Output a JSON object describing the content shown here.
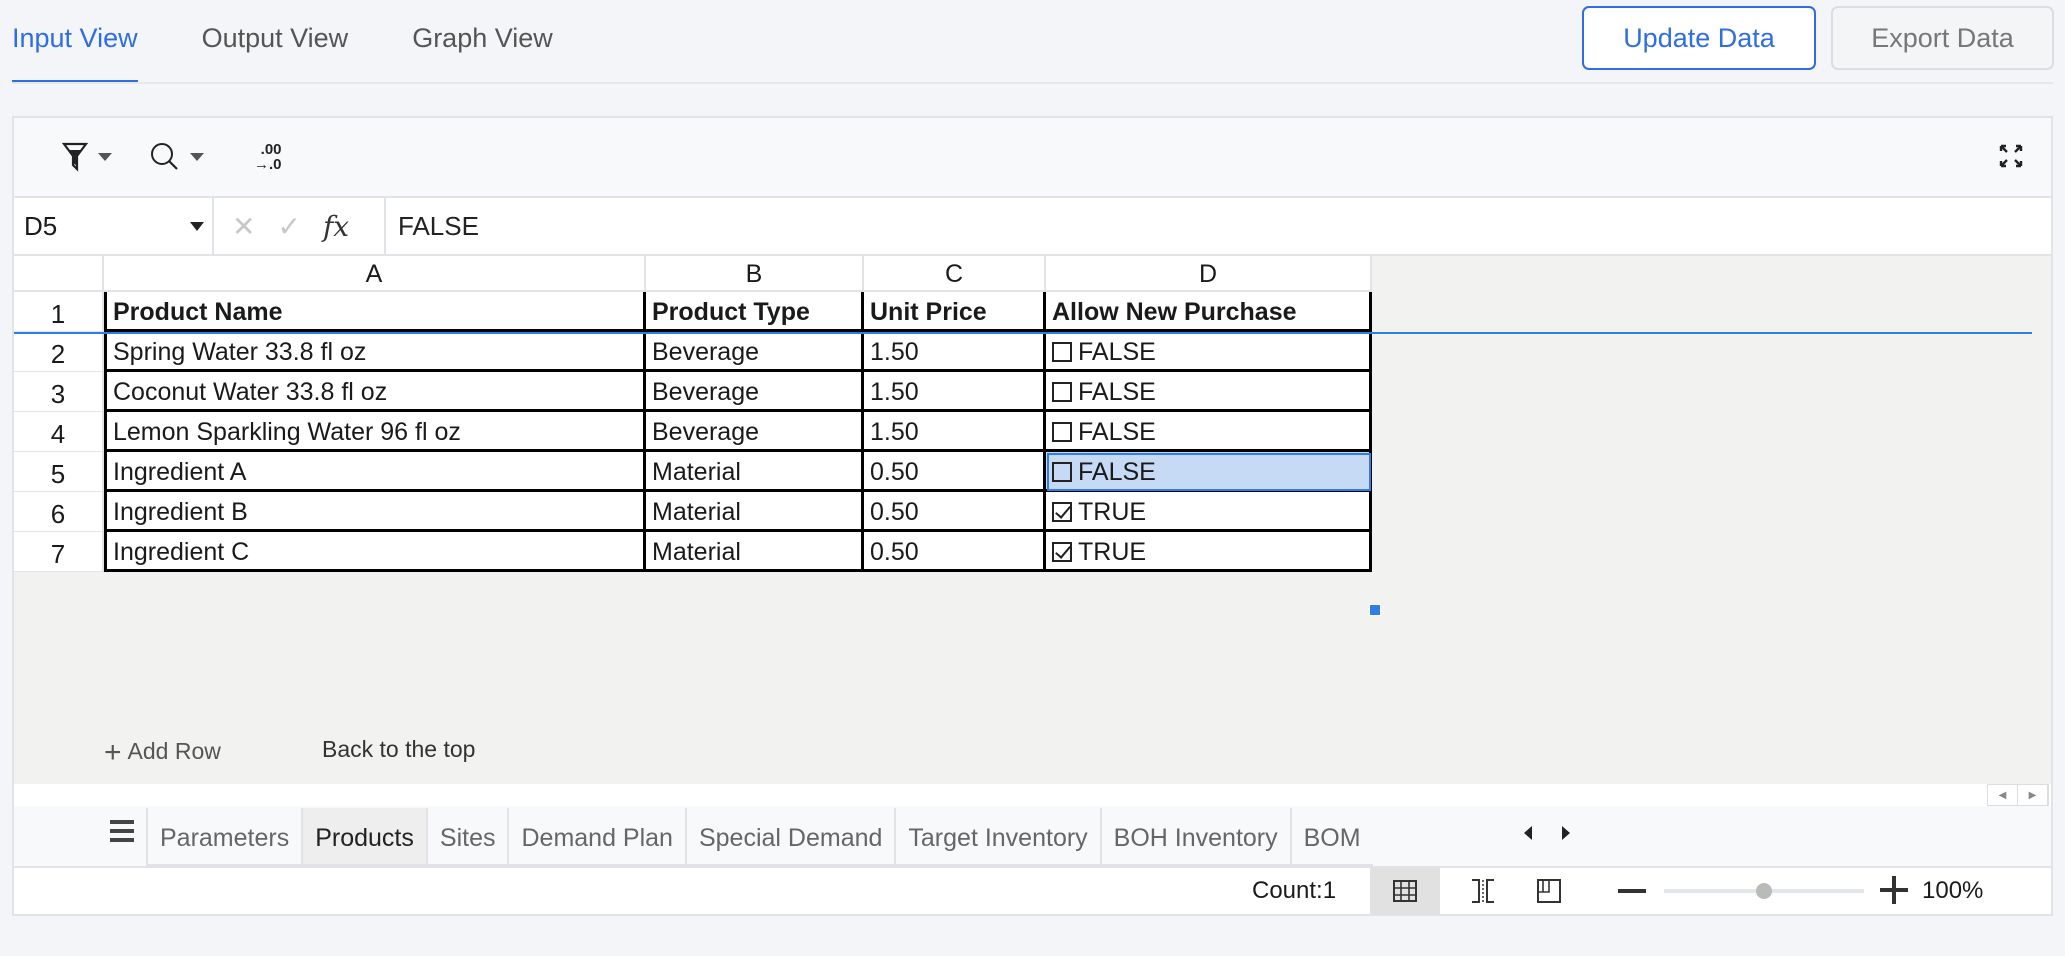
{
  "view_tabs": [
    {
      "label": "Input View",
      "active": true
    },
    {
      "label": "Output View",
      "active": false
    },
    {
      "label": "Graph View",
      "active": false
    }
  ],
  "actions": {
    "update": "Update Data",
    "export": "Export Data"
  },
  "toolbar": {
    "icons": [
      "filter-icon",
      "search-icon",
      "decrease-decimal-icon",
      "fullscreen-icon"
    ],
    "decimal_top": ".00",
    "decimal_bottom": "→.0"
  },
  "formula_bar": {
    "cell_ref": "D5",
    "cancel_glyph": "✕",
    "confirm_glyph": "✓",
    "fx_label": "fx",
    "value": "FALSE"
  },
  "grid": {
    "columns": [
      "A",
      "B",
      "C",
      "D"
    ],
    "header_row": {
      "num": "1",
      "cells": [
        "Product Name",
        "Product Type",
        "Unit Price",
        "Allow New Purchase"
      ]
    },
    "rows": [
      {
        "num": "2",
        "name": "Spring Water 33.8 fl oz",
        "type": "Beverage",
        "price": "1.50",
        "allow": "FALSE"
      },
      {
        "num": "3",
        "name": "Coconut Water 33.8 fl oz",
        "type": "Beverage",
        "price": "1.50",
        "allow": "FALSE"
      },
      {
        "num": "4",
        "name": "Lemon Sparkling Water 96 fl oz",
        "type": "Beverage",
        "price": "1.50",
        "allow": "FALSE"
      },
      {
        "num": "5",
        "name": "Ingredient A",
        "type": "Material",
        "price": "0.50",
        "allow": "FALSE"
      },
      {
        "num": "6",
        "name": "Ingredient B",
        "type": "Material",
        "price": "0.50",
        "allow": "TRUE"
      },
      {
        "num": "7",
        "name": "Ingredient C",
        "type": "Material",
        "price": "0.50",
        "allow": "TRUE"
      }
    ],
    "selected_cell": "D5"
  },
  "links": {
    "add_row": "Add Row",
    "add_row_glyph": "+",
    "back_top": "Back to the top"
  },
  "sheet_tabs": [
    {
      "label": "Parameters",
      "active": false
    },
    {
      "label": "Products",
      "active": true
    },
    {
      "label": "Sites",
      "active": false
    },
    {
      "label": "Demand Plan",
      "active": false
    },
    {
      "label": "Special Demand",
      "active": false
    },
    {
      "label": "Target Inventory",
      "active": false
    },
    {
      "label": "BOH Inventory",
      "active": false
    },
    {
      "label": "BOM",
      "active": false
    }
  ],
  "status": {
    "count": "Count:1",
    "zoom": "100%",
    "zoom_slider_fraction": 0.5
  },
  "scroll_glyphs": {
    "up": "▲",
    "down": "▼",
    "left": "◀",
    "right": "▶"
  }
}
